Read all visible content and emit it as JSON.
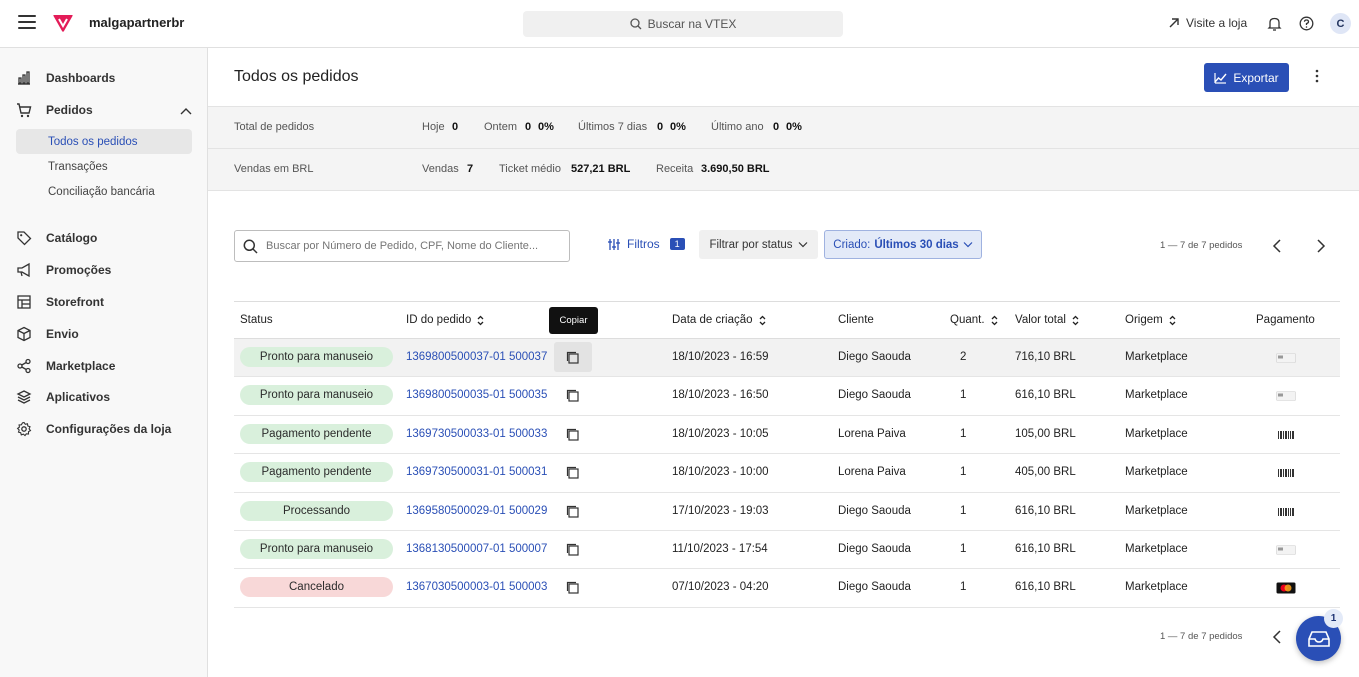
{
  "topbar": {
    "store_name": "malgapartnerbr",
    "search_placeholder": "Buscar na VTEX",
    "visit_store": "Visite a loja",
    "user_initial": "C",
    "brand_color": "#e31c58"
  },
  "sidebar": {
    "items": [
      {
        "label": "Dashboards",
        "icon": "chart-icon"
      },
      {
        "label": "Pedidos",
        "icon": "cart-icon"
      },
      {
        "label": "Catálogo",
        "icon": "tag-icon"
      },
      {
        "label": "Promoções",
        "icon": "megaphone-icon"
      },
      {
        "label": "Storefront",
        "icon": "layout-icon"
      },
      {
        "label": "Envio",
        "icon": "box-icon"
      },
      {
        "label": "Marketplace",
        "icon": "share-icon"
      },
      {
        "label": "Aplicativos",
        "icon": "layers-icon"
      },
      {
        "label": "Configurações da loja",
        "icon": "gear-icon"
      }
    ],
    "sub_items": [
      "Todos os pedidos",
      "Transações",
      "Conciliação bancária"
    ]
  },
  "header": {
    "title": "Todos os pedidos",
    "export_label": "Exportar"
  },
  "stats": {
    "orders_label": "Total de pedidos",
    "today_label": "Hoje",
    "today_value": "0",
    "yesterday_label": "Ontem",
    "yesterday_value": "0",
    "yesterday_pct": "0%",
    "week_label": "Últimos 7 dias",
    "week_value": "0",
    "week_pct": "0%",
    "year_label": "Último ano",
    "year_value": "0",
    "year_pct": "0%",
    "sales_label": "Vendas em BRL",
    "vendas_label": "Vendas",
    "vendas_value": "7",
    "ticket_label": "Ticket médio",
    "ticket_value": "527,21 BRL",
    "receita_label": "Receita",
    "receita_value": "3.690,50 BRL"
  },
  "filters": {
    "search_placeholder": "Buscar por Número de Pedido, CPF, Nome do Cliente...",
    "filters_label": "Filtros",
    "filters_count": "1",
    "status_label": "Filtrar por status",
    "date_prefix": "Criado:",
    "date_value": "Últimos 30 dias",
    "pager_text": "1 — 7 de 7 pedidos"
  },
  "table": {
    "columns": [
      "Status",
      "ID do pedido",
      "Data de criação",
      "Cliente",
      "Quant.",
      "Valor total",
      "Origem",
      "Pagamento"
    ],
    "tooltip": "Copiar",
    "rows": [
      {
        "status": "Pronto para manuseio",
        "status_color": "green",
        "id": "1369800500037-01 500037",
        "date": "18/10/2023 - 16:59",
        "client": "Diego Saouda",
        "qty": "2",
        "total": "716,10 BRL",
        "origin": "Marketplace",
        "payment": "card-icon"
      },
      {
        "status": "Pronto para manuseio",
        "status_color": "green",
        "id": "1369800500035-01 500035",
        "date": "18/10/2023 - 16:50",
        "client": "Diego Saouda",
        "qty": "1",
        "total": "616,10 BRL",
        "origin": "Marketplace",
        "payment": "card-icon"
      },
      {
        "status": "Pagamento pendente",
        "status_color": "green",
        "id": "1369730500033-01 500033",
        "date": "18/10/2023 - 10:05",
        "client": "Lorena Paiva",
        "qty": "1",
        "total": "105,00 BRL",
        "origin": "Marketplace",
        "payment": "barcode-icon"
      },
      {
        "status": "Pagamento pendente",
        "status_color": "green",
        "id": "1369730500031-01 500031",
        "date": "18/10/2023 - 10:00",
        "client": "Lorena Paiva",
        "qty": "1",
        "total": "405,00 BRL",
        "origin": "Marketplace",
        "payment": "barcode-icon"
      },
      {
        "status": "Processando",
        "status_color": "green",
        "id": "1369580500029-01 500029",
        "date": "17/10/2023 - 19:03",
        "client": "Diego Saouda",
        "qty": "1",
        "total": "616,10 BRL",
        "origin": "Marketplace",
        "payment": "barcode-icon"
      },
      {
        "status": "Pronto para manuseio",
        "status_color": "green",
        "id": "1368130500007-01 500007",
        "date": "11/10/2023 - 17:54",
        "client": "Diego Saouda",
        "qty": "1",
        "total": "616,10 BRL",
        "origin": "Marketplace",
        "payment": "card-icon"
      },
      {
        "status": "Cancelado",
        "status_color": "red",
        "id": "1367030500003-01 500003",
        "date": "07/10/2023 - 04:20",
        "client": "Diego Saouda",
        "qty": "1",
        "total": "616,10 BRL",
        "origin": "Marketplace",
        "payment": "mastercard-icon"
      }
    ]
  },
  "fab": {
    "badge": "1"
  }
}
